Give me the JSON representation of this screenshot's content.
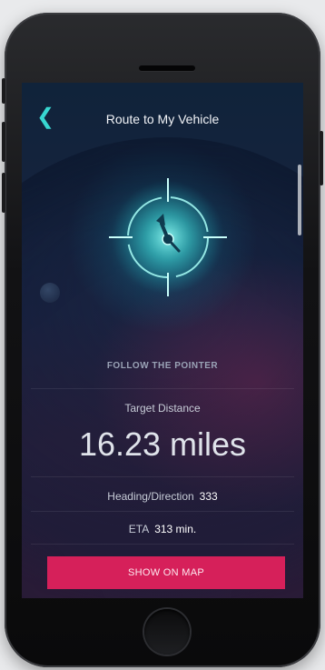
{
  "header": {
    "back_icon": "chevron-left-icon",
    "title": "Route to My Vehicle"
  },
  "compass": {
    "icon": "crosshair-pointer-icon",
    "accent_color": "#38d6d0"
  },
  "guidance": {
    "instruction": "FOLLOW THE POINTER",
    "target_label": "Target Distance",
    "target_value": "16.23 miles",
    "heading_label": "Heading/Direction",
    "heading_value": "333",
    "eta_label": "ETA",
    "eta_value": "313 min."
  },
  "actions": {
    "show_on_map": "SHOW ON MAP",
    "button_color": "#d6205a"
  }
}
